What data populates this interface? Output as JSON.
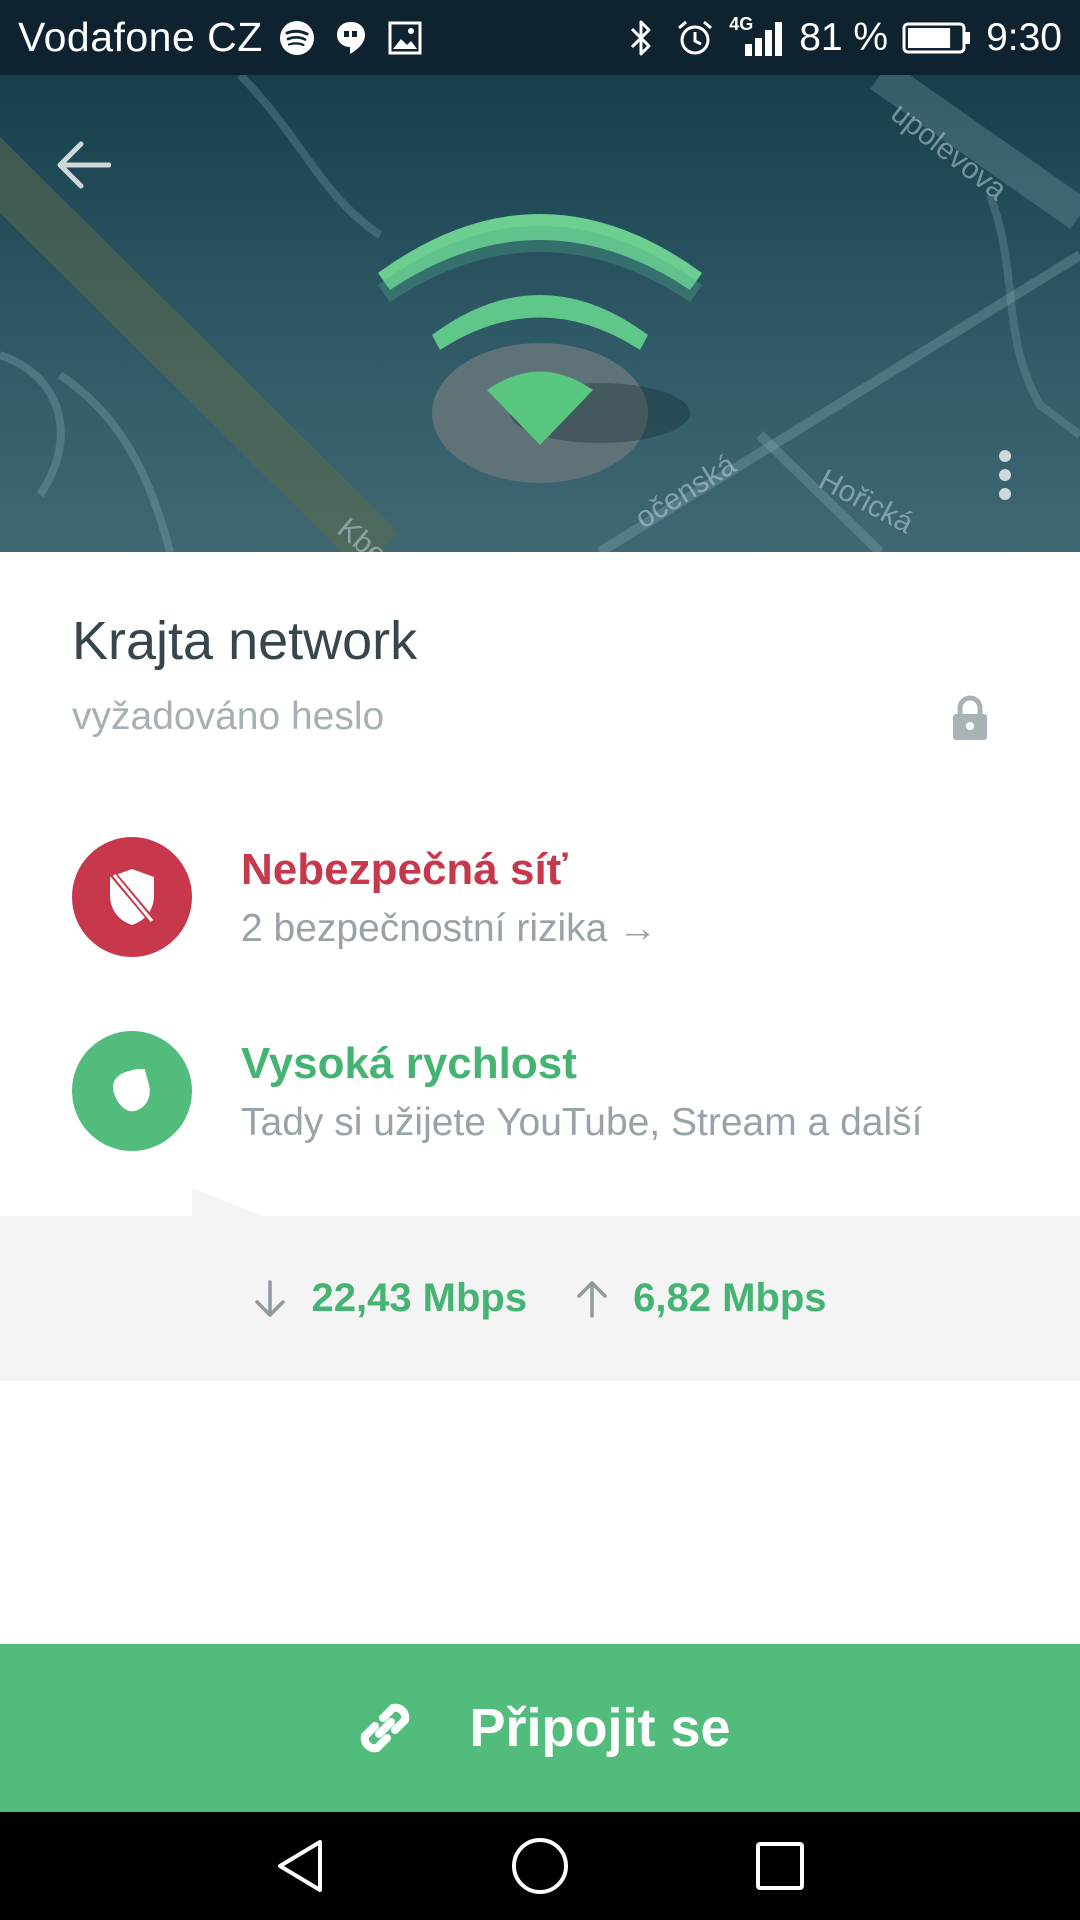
{
  "status_bar": {
    "carrier": "Vodafone CZ",
    "network_type": "4G",
    "battery_percent": "81 %",
    "battery_level": 0.81,
    "time": "9:30",
    "icons": [
      "spotify-icon",
      "hangouts-icon",
      "gallery-icon",
      "bluetooth-icon",
      "alarm-icon",
      "signal-icon",
      "battery-icon"
    ]
  },
  "header": {
    "back_icon": "arrow-left-icon",
    "menu_icon": "more-vertical-icon",
    "wifi_icon": "wifi-icon",
    "streets": [
      "upolevova",
      "očenská",
      "Hořická",
      "Kbe"
    ]
  },
  "network": {
    "name": "Krajta network",
    "security": "vyžadováno heslo",
    "lock_icon": "lock-icon"
  },
  "risk": {
    "title": "Nebezpečná síť",
    "detail": "2 bezpečnostní rizika →",
    "icon": "shield-off-icon",
    "color": "#c8384d"
  },
  "speed_rating": {
    "title": "Vysoká rychlost",
    "detail": "Tady si užijete YouTube, Stream a další",
    "icon": "speedometer-icon",
    "color": "#45b472"
  },
  "speeds": {
    "download": "22,43 Mbps",
    "upload": "6,82 Mbps"
  },
  "connect_button": {
    "label": "Připojit se",
    "icon": "link-icon",
    "color": "#52bc7d"
  },
  "nav": {
    "back": "nav-back-icon",
    "home": "nav-home-icon",
    "recents": "nav-recents-icon"
  }
}
